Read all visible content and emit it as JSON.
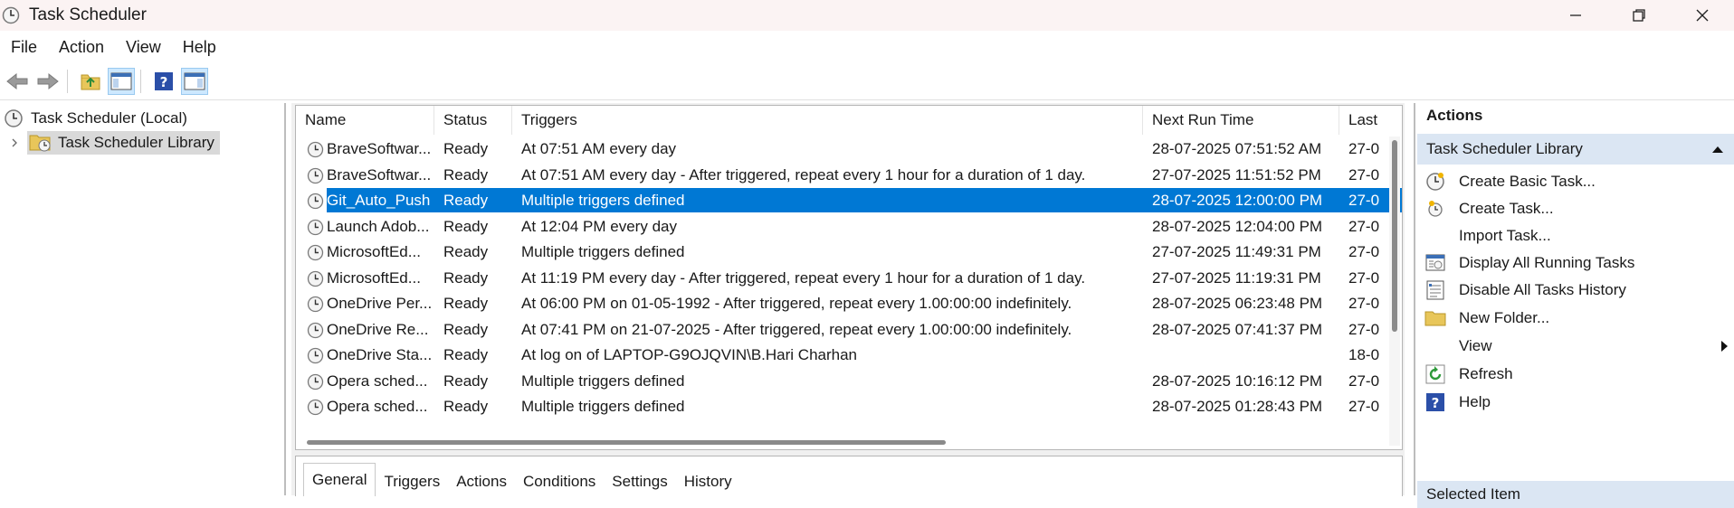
{
  "window": {
    "title": "Task Scheduler",
    "minimize_icon": "minimize-icon",
    "maximize_icon": "restore-icon",
    "close_icon": "close-icon"
  },
  "menu": [
    "File",
    "Action",
    "View",
    "Help"
  ],
  "toolbar": {
    "buttons": [
      "back-icon",
      "forward-icon",
      "up-folder-icon",
      "show-hide-console-tree-icon",
      "help-icon",
      "show-hide-action-pane-icon"
    ]
  },
  "tree": {
    "root_label": "Task Scheduler (Local)",
    "library_label": "Task Scheduler Library"
  },
  "columns": [
    "Name",
    "Status",
    "Triggers",
    "Next Run Time",
    "Last"
  ],
  "tasks": [
    {
      "name": "BraveSoftwar...",
      "status": "Ready",
      "triggers": "At 07:51 AM every day",
      "next_run": "28-07-2025 07:51:52 AM",
      "last": "27-0"
    },
    {
      "name": "BraveSoftwar...",
      "status": "Ready",
      "triggers": "At 07:51 AM every day - After triggered, repeat every 1 hour for a duration of 1 day.",
      "next_run": "27-07-2025 11:51:52 PM",
      "last": "27-0"
    },
    {
      "name": "Git_Auto_Push",
      "status": "Ready",
      "triggers": "Multiple triggers defined",
      "next_run": "28-07-2025 12:00:00 PM",
      "last": "27-0",
      "selected": true
    },
    {
      "name": "Launch Adob...",
      "status": "Ready",
      "triggers": "At 12:04 PM every day",
      "next_run": "28-07-2025 12:04:00 PM",
      "last": "27-0"
    },
    {
      "name": "MicrosoftEd...",
      "status": "Ready",
      "triggers": "Multiple triggers defined",
      "next_run": "27-07-2025 11:49:31 PM",
      "last": "27-0"
    },
    {
      "name": "MicrosoftEd...",
      "status": "Ready",
      "triggers": "At 11:19 PM every day - After triggered, repeat every 1 hour for a duration of 1 day.",
      "next_run": "27-07-2025 11:19:31 PM",
      "last": "27-0"
    },
    {
      "name": "OneDrive Per...",
      "status": "Ready",
      "triggers": "At 06:00 PM on 01-05-1992 - After triggered, repeat every 1.00:00:00 indefinitely.",
      "next_run": "28-07-2025 06:23:48 PM",
      "last": "27-0"
    },
    {
      "name": "OneDrive Re...",
      "status": "Ready",
      "triggers": "At 07:41 PM on 21-07-2025 - After triggered, repeat every 1.00:00:00 indefinitely.",
      "next_run": "28-07-2025 07:41:37 PM",
      "last": "27-0"
    },
    {
      "name": "OneDrive Sta...",
      "status": "Ready",
      "triggers": "At log on of LAPTOP-G9OJQVIN\\B.Hari Charhan",
      "next_run": "",
      "last": "18-0"
    },
    {
      "name": "Opera sched...",
      "status": "Ready",
      "triggers": "Multiple triggers defined",
      "next_run": "28-07-2025 10:16:12 PM",
      "last": "27-0"
    },
    {
      "name": "Opera sched...",
      "status": "Ready",
      "triggers": "Multiple triggers defined",
      "next_run": "28-07-2025 01:28:43 PM",
      "last": "27-0"
    }
  ],
  "tabs": [
    "General",
    "Triggers",
    "Actions",
    "Conditions",
    "Settings",
    "History"
  ],
  "actions_pane": {
    "title": "Actions",
    "section": "Task Scheduler Library",
    "items": [
      {
        "label": "Create Basic Task...",
        "icon": "create-basic-task-icon"
      },
      {
        "label": "Create Task...",
        "icon": "create-task-icon"
      },
      {
        "label": "Import Task...",
        "icon": ""
      },
      {
        "label": "Display All Running Tasks",
        "icon": "running-tasks-icon"
      },
      {
        "label": "Disable All Tasks History",
        "icon": "tasks-history-icon"
      },
      {
        "label": "New Folder...",
        "icon": "new-folder-icon"
      },
      {
        "label": "View",
        "icon": ""
      },
      {
        "label": "Refresh",
        "icon": "refresh-icon"
      },
      {
        "label": "Help",
        "icon": "help-icon"
      }
    ],
    "section2": "Selected Item"
  },
  "colors": {
    "selection": "#0078d4",
    "section_header": "#dbe6f3",
    "title_bar": "#fbf3f3"
  }
}
